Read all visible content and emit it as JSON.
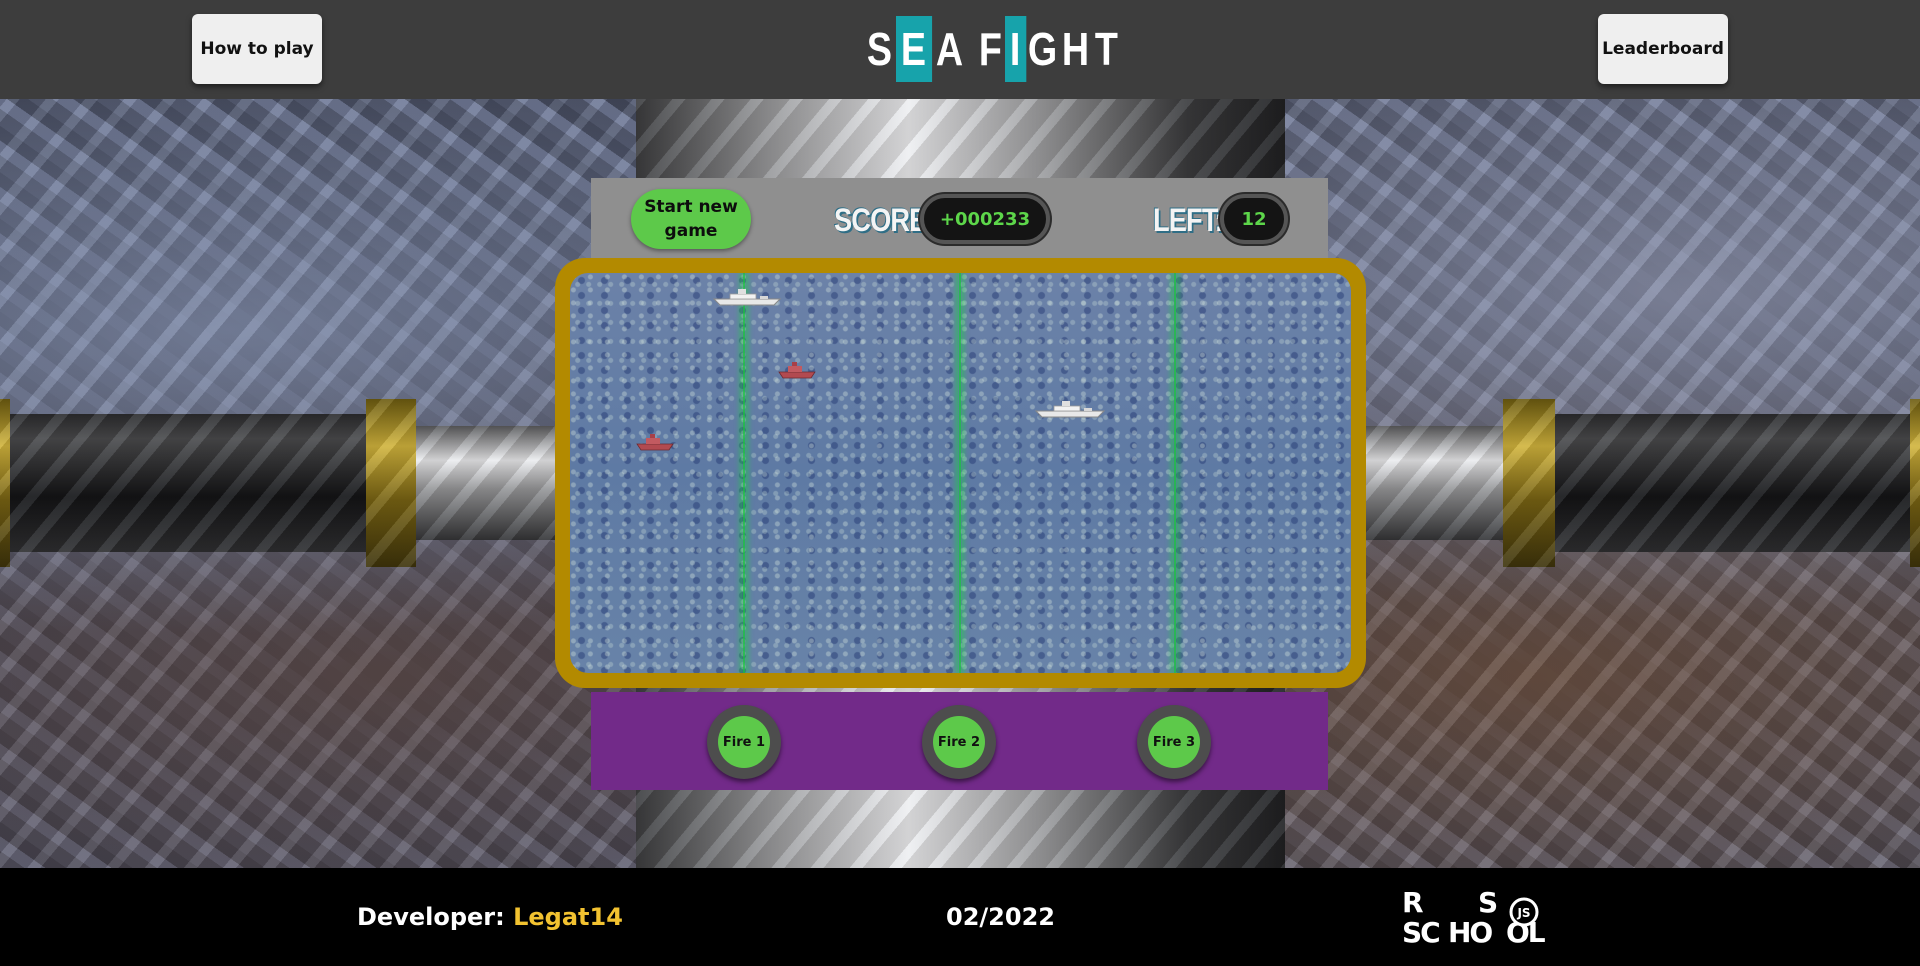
{
  "header": {
    "how_to_play": "How to play",
    "leaderboard": "Leaderboard",
    "logo_letters": [
      "S",
      "E",
      "A",
      "",
      "F",
      "I",
      "G",
      "H",
      "T"
    ]
  },
  "game": {
    "start_button": "Start new\ngame",
    "score_label": "SCORE:",
    "score_value": "+000233",
    "left_label": "LEFT:",
    "left_value": "12",
    "fire_buttons": [
      "Fire 1",
      "Fire 2",
      "Fire 3"
    ]
  },
  "footer": {
    "developer_label": "Developer: ",
    "developer_name": "Legat14",
    "date": "02/2022",
    "school_logo_text": "RS SCHOOL JS"
  },
  "colors": {
    "accent_teal": "#17a3ab",
    "frame_gold": "#b38a00",
    "panel_purple": "#722a89",
    "button_green": "#5dc94a",
    "laser_green": "#15c83a",
    "developer_name": "#f2c230"
  }
}
